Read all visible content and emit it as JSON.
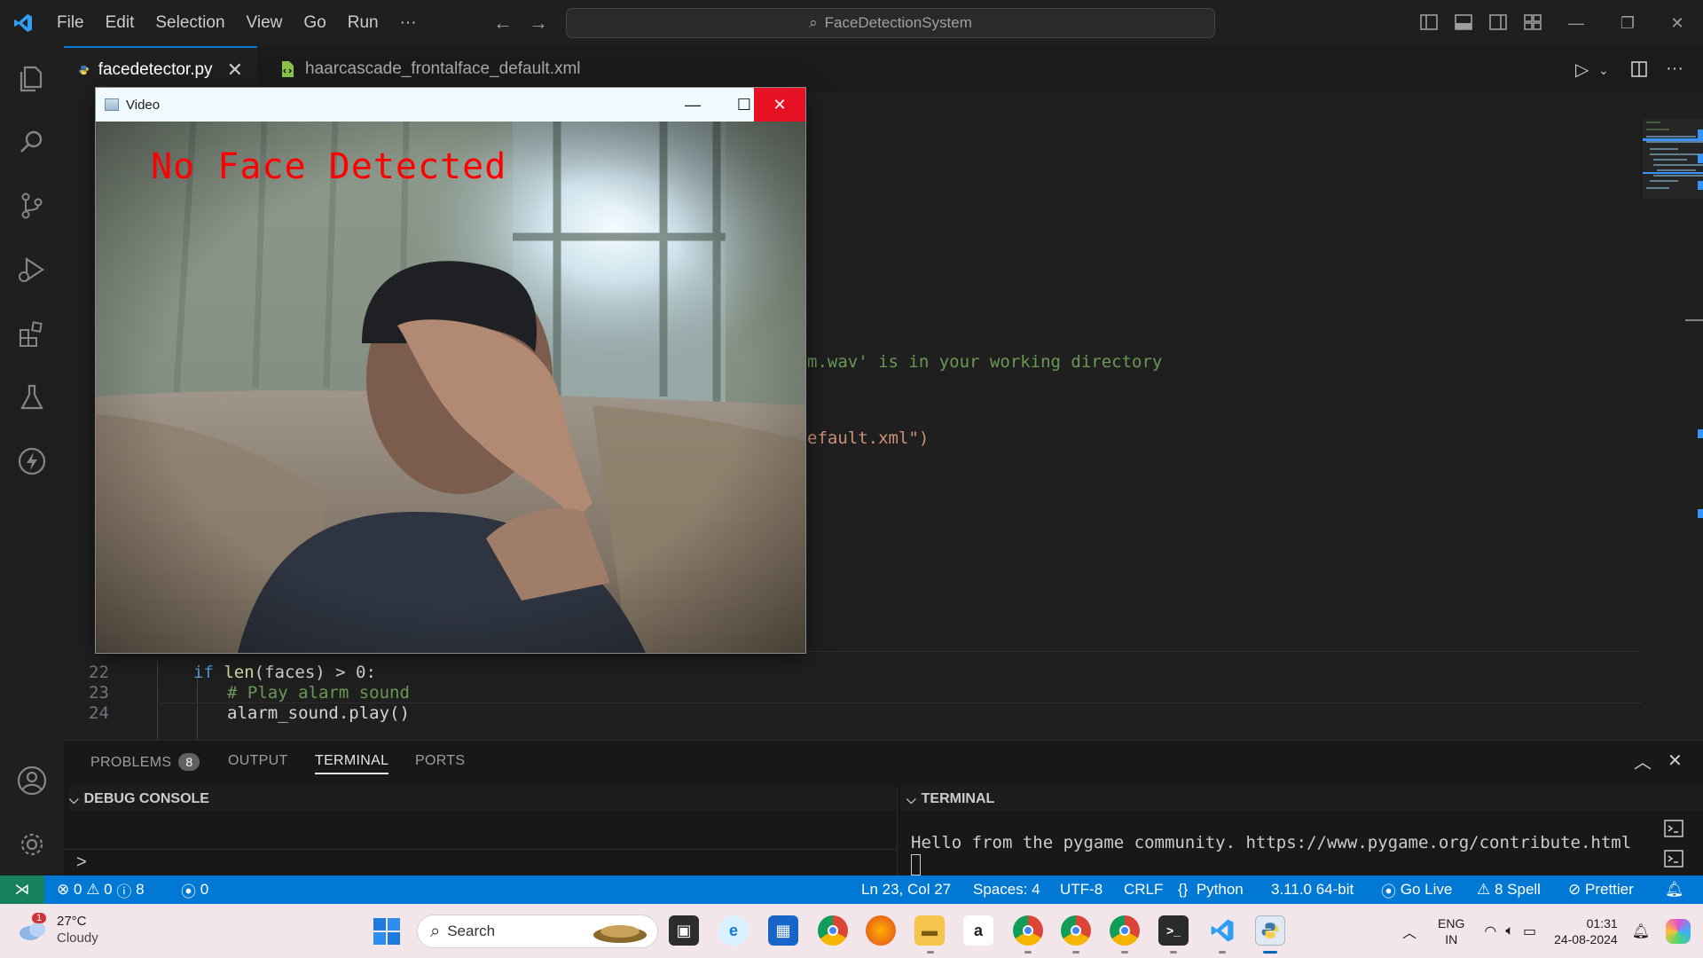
{
  "titlebar": {
    "menu": [
      "File",
      "Edit",
      "Selection",
      "View",
      "Go",
      "Run",
      "···"
    ],
    "search_text": "FaceDetectionSystem"
  },
  "tabs": [
    {
      "label": "facedetector.py",
      "active": true,
      "icon": "python-icon"
    },
    {
      "label": "haarcascade_frontalface_default.xml",
      "active": false,
      "icon": "xml-file-icon"
    }
  ],
  "editor": {
    "partial_lines": {
      "alarm_comment": "m.wav' is in your working directory",
      "cascade_path": "efault.xml\")"
    },
    "lines": [
      {
        "number": "22",
        "indent": 1,
        "tokens": [
          {
            "t": "if ",
            "c": "kw"
          },
          {
            "t": "len",
            "c": "fn"
          },
          {
            "t": "(faces) > 0:",
            "c": ""
          }
        ]
      },
      {
        "number": "23",
        "indent": 2,
        "tokens": [
          {
            "t": "# Play alarm sound",
            "c": "cm"
          }
        ]
      },
      {
        "number": "24",
        "indent": 2,
        "tokens": [
          {
            "t": "alarm_sound.play()",
            "c": ""
          }
        ]
      }
    ]
  },
  "video_window": {
    "title": "Video",
    "overlay_text": "No Face Detected"
  },
  "panel": {
    "tabs": [
      {
        "label": "PROBLEMS",
        "badge": "8",
        "active": false
      },
      {
        "label": "OUTPUT",
        "active": false
      },
      {
        "label": "TERMINAL",
        "active": true
      },
      {
        "label": "PORTS",
        "active": false
      }
    ],
    "debug_header": "DEBUG CONSOLE",
    "terminal_header": "TERMINAL",
    "prompt_glyph": ">",
    "terminal_output": "Hello from the pygame community. https://www.pygame.org/contribute.html"
  },
  "statusbar": {
    "errors": "0",
    "warnings": "0",
    "infos": "8",
    "ports": "0",
    "position": "Ln 23, Col 27",
    "spaces": "Spaces: 4",
    "encoding": "UTF-8",
    "eol": "CRLF",
    "language": "Python",
    "interpreter": "3.11.0 64-bit",
    "go_live": "Go Live",
    "spell": "8 Spell",
    "prettier": "Prettier"
  },
  "taskbar": {
    "weather_temp": "27°C",
    "weather_desc": "Cloudy",
    "weather_badge": "1",
    "search_placeholder": "Search",
    "lang_top": "ENG",
    "lang_bottom": "IN",
    "time": "01:31",
    "date": "24-08-2024"
  },
  "colors": {
    "accent": "#0078d4",
    "overlay_red": "#ff0000",
    "close_red": "#e81123"
  }
}
